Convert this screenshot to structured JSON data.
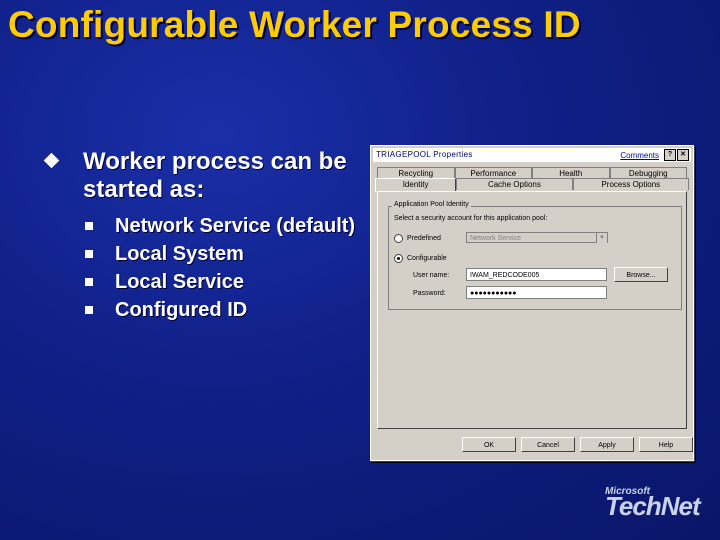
{
  "slide": {
    "title": "Configurable Worker Process ID",
    "bullet": "Worker process can be started as:",
    "sub_bullets": [
      "Network Service (default)",
      "Local System",
      "Local Service",
      "Configured ID"
    ]
  },
  "dialog": {
    "title": "TRIAGEPOOL Properties",
    "comments_link": "Comments",
    "help_btn": "?",
    "close_btn": "✕",
    "tabs_row1": [
      "Recycling",
      "Performance",
      "Health",
      "Debugging"
    ],
    "tabs_row2": [
      "Identity",
      "Cache Options",
      "Process Options"
    ],
    "groupbox_label": "Application Pool Identity",
    "prompt": "Select a security account for this application pool:",
    "predefined_label": "Predefined",
    "predefined_value": "Network Service",
    "configurable_label": "Configurable",
    "username_label": "User name:",
    "username_value": "IWAM_REDCODE005",
    "password_label": "Password:",
    "password_value": "●●●●●●●●●●●",
    "browse_label": "Browse...",
    "buttons": {
      "ok": "OK",
      "cancel": "Cancel",
      "apply": "Apply",
      "help": "Help"
    }
  },
  "branding": {
    "line1": "Microsoft",
    "line2": "TechNet"
  },
  "colors": {
    "title": "#ffcc00",
    "background": "#0f1f86"
  }
}
